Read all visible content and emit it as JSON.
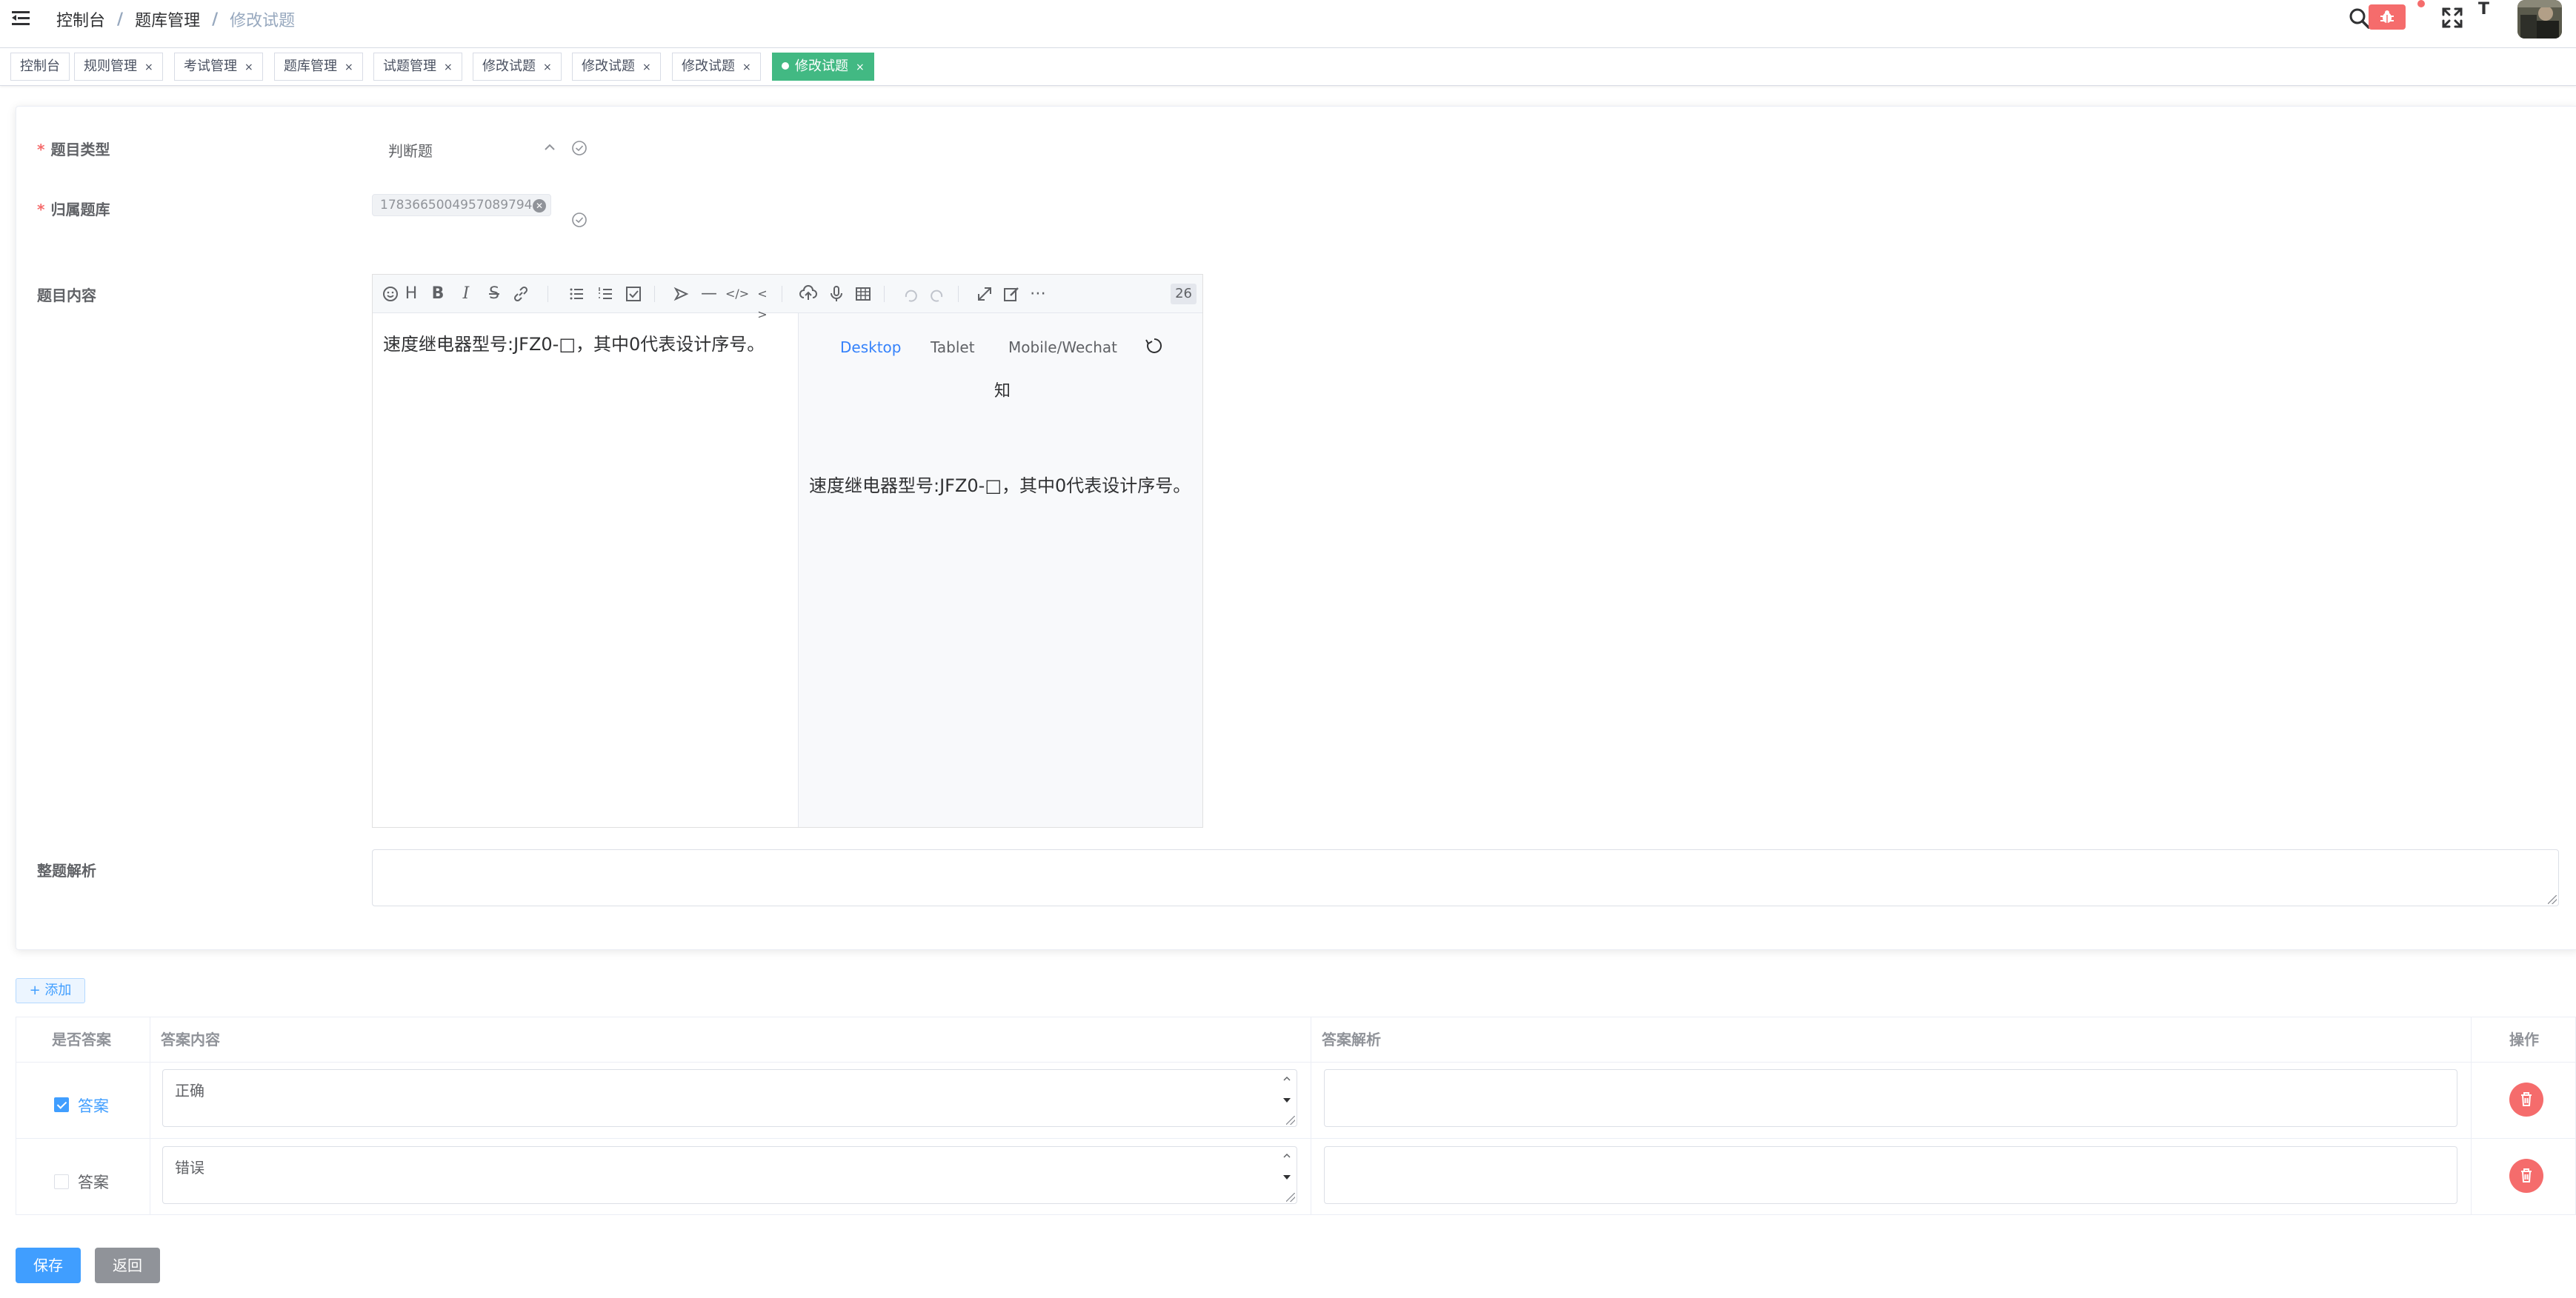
{
  "breadcrumb": {
    "items": [
      "控制台",
      "题库管理"
    ],
    "current": "修改试题",
    "separator": "/"
  },
  "navbar": {
    "size_icon_text": "T",
    "bug_icon": "bug-icon"
  },
  "tags": [
    {
      "label": "控制台",
      "closable": false,
      "active": false
    },
    {
      "label": "规则管理",
      "closable": true,
      "active": false
    },
    {
      "label": "考试管理",
      "closable": true,
      "active": false
    },
    {
      "label": "题库管理",
      "closable": true,
      "active": false
    },
    {
      "label": "试题管理",
      "closable": true,
      "active": false
    },
    {
      "label": "修改试题",
      "closable": true,
      "active": false
    },
    {
      "label": "修改试题",
      "closable": true,
      "active": false
    },
    {
      "label": "修改试题",
      "closable": true,
      "active": false
    },
    {
      "label": "修改试题",
      "closable": true,
      "active": true
    }
  ],
  "tag_close": "×",
  "form": {
    "type_label": "题目类型",
    "type_value": "判断题",
    "bank_label": "归属题库",
    "bank_chip": "1783665004957089794",
    "content_label": "题目内容",
    "analysis_label": "整题解析",
    "required_mark": "*"
  },
  "editor": {
    "count": "26",
    "content": "速度继电器型号:JFZ0-□，其中0代表设计序号。",
    "preview_tabs": [
      "Desktop",
      "Tablet",
      "Mobile/Wechat"
    ],
    "preview_active": "Desktop",
    "preview_extra": "知",
    "preview_content": "速度继电器型号:JFZ0-□，其中0代表设计序号。"
  },
  "add_button": "+ 添加",
  "table": {
    "headers": [
      "是否答案",
      "答案内容",
      "答案解析",
      "操作"
    ],
    "rows": [
      {
        "checked": true,
        "check_label": "答案",
        "content": "正确",
        "analysis": ""
      },
      {
        "checked": false,
        "check_label": "答案",
        "content": "错误",
        "analysis": ""
      }
    ]
  },
  "buttons": {
    "save": "保存",
    "back": "返回"
  },
  "colors": {
    "primary": "#409eff",
    "success_tag": "#42b983",
    "danger": "#f56c6c",
    "info": "#909399"
  }
}
